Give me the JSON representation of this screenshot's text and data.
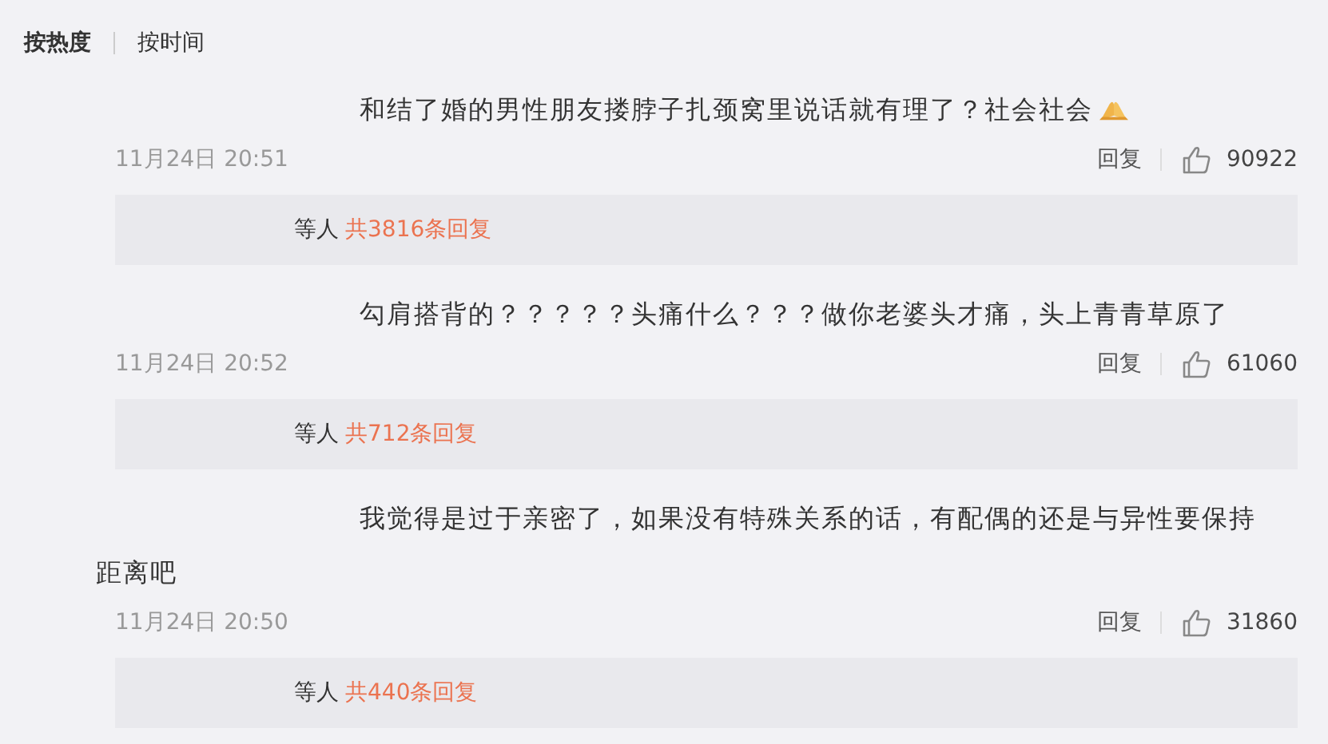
{
  "sort_tabs": [
    {
      "label": "按热度",
      "selected": true
    },
    {
      "label": "按时间",
      "selected": false
    }
  ],
  "comments": [
    {
      "text": "和结了婚的男性朋友搂脖子扎颈窝里说话就有理了？社会社会",
      "emoji": true,
      "time": "11月24日 20:51",
      "reply": "回复",
      "likes": "90922",
      "replies_prefix": "等人",
      "replies_link": "共3816条回复"
    },
    {
      "text": "勾肩搭背的？？？？？头痛什么？？？做你老婆头才痛，头上青青草原了",
      "emoji": false,
      "time": "11月24日 20:52",
      "reply": "回复",
      "likes": "61060",
      "replies_prefix": "等人",
      "replies_link": "共712条回复"
    },
    {
      "text": "我觉得是过于亲密了，如果没有特殊关系的话，有配偶的还是与异性要保持距离吧",
      "emoji": false,
      "time": "11月24日 20:50",
      "reply": "回复",
      "likes": "31860",
      "replies_prefix": "等人",
      "replies_link": "共440条回复"
    }
  ]
}
